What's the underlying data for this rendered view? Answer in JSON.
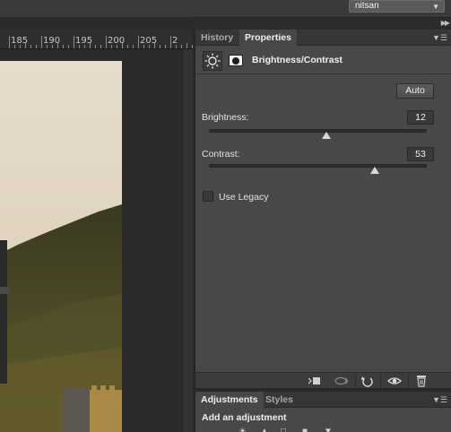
{
  "workspace": {
    "selected": "nitsan"
  },
  "ruler": {
    "labels": [
      "185",
      "190",
      "195",
      "200",
      "205",
      "2"
    ]
  },
  "properties_panel": {
    "tabs": [
      {
        "label": "History",
        "active": false
      },
      {
        "label": "Properties",
        "active": true
      }
    ],
    "title": "Brightness/Contrast",
    "auto_label": "Auto",
    "brightness": {
      "label": "Brightness:",
      "value": "12",
      "slider_fraction": 0.54
    },
    "contrast": {
      "label": "Contrast:",
      "value": "53",
      "slider_fraction": 0.76
    },
    "use_legacy": {
      "label": "Use Legacy",
      "checked": false
    },
    "footer_icons": [
      "clip-to-layer-icon",
      "view-previous-state-icon",
      "reset-icon",
      "visibility-eye-icon",
      "trash-icon"
    ]
  },
  "adjustments_panel": {
    "tabs": [
      {
        "label": "Adjustments",
        "active": true
      },
      {
        "label": "Styles",
        "active": false
      }
    ],
    "title": "Add an adjustment"
  },
  "colors": {
    "panel_bg": "#484848",
    "app_bg": "#282828",
    "tab_bar": "#363636"
  }
}
